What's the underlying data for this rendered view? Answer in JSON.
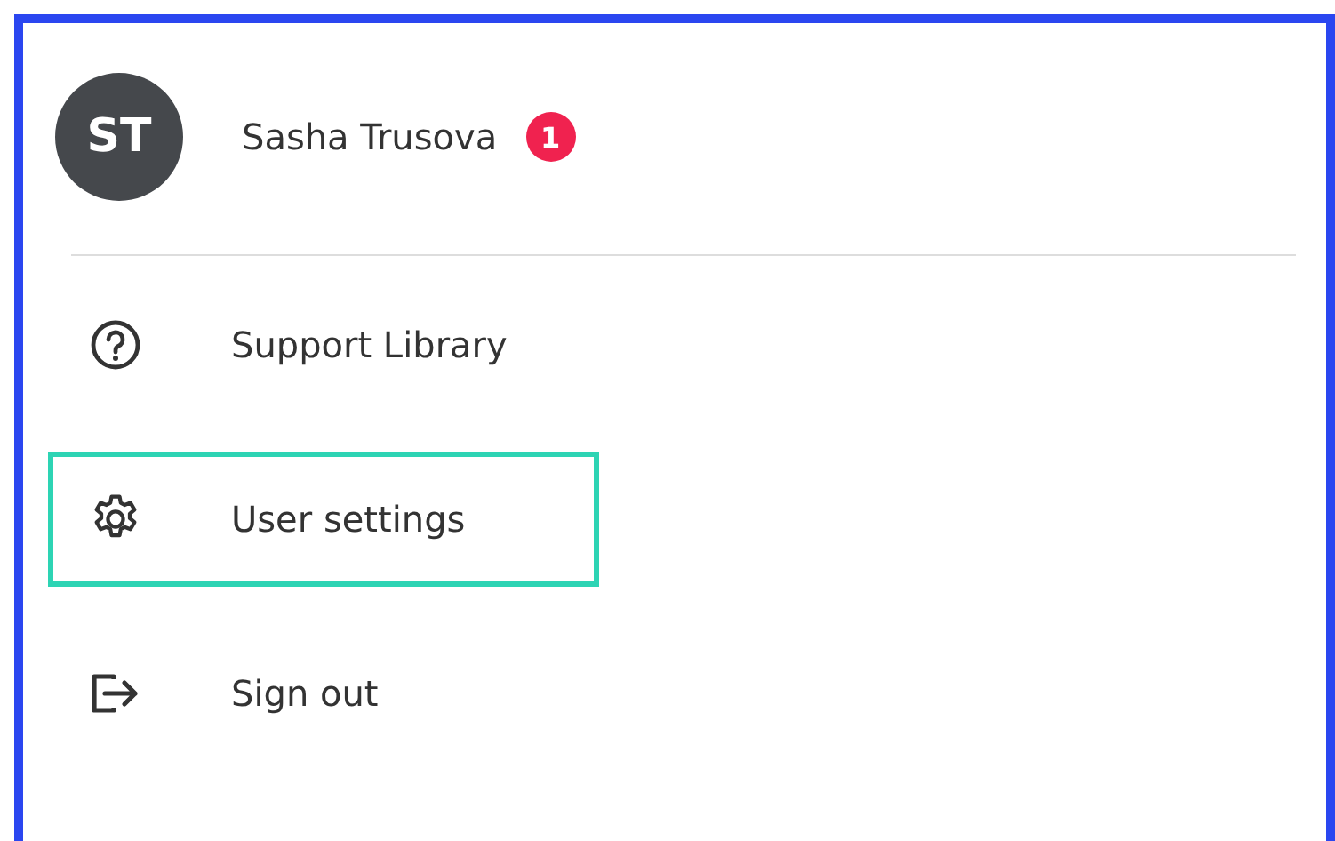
{
  "user": {
    "initials": "ST",
    "name": "Sasha Trusova",
    "badge": "1"
  },
  "menu": [
    {
      "kind": "help",
      "label": "Support Library",
      "selected": false
    },
    {
      "kind": "settings",
      "label": "User settings",
      "selected": true
    },
    {
      "kind": "signout",
      "label": "Sign out",
      "selected": false
    }
  ]
}
